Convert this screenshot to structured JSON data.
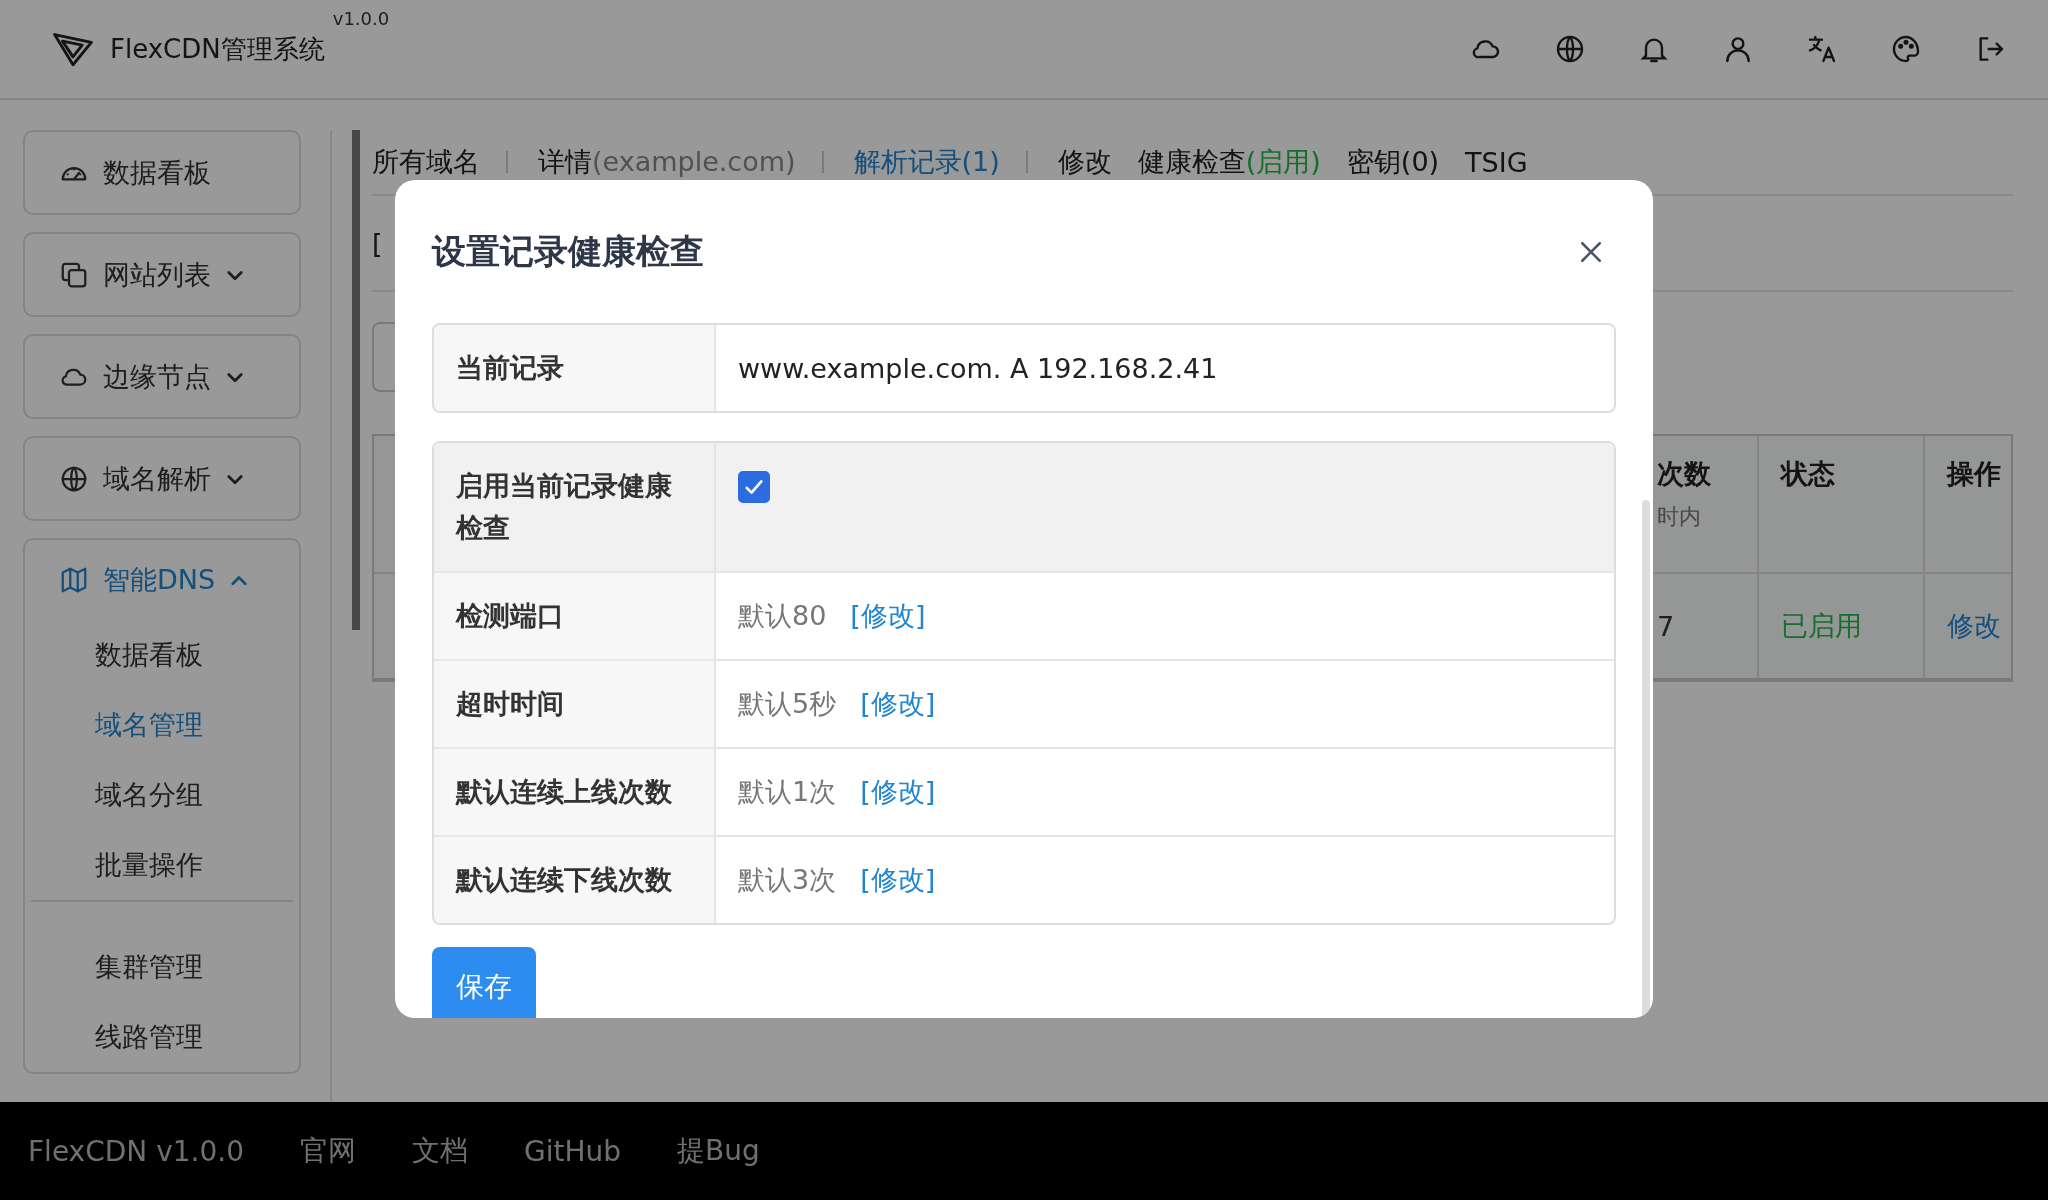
{
  "header": {
    "logo_text": "FlexCDN管理系统",
    "version": "v1.0.0"
  },
  "sidebar": {
    "items": [
      {
        "label": "数据看板",
        "kind": "link",
        "selected": false
      },
      {
        "label": "网站列表",
        "kind": "menu",
        "selected": false,
        "expanded": false
      },
      {
        "label": "边缘节点",
        "kind": "menu",
        "selected": false,
        "expanded": false
      },
      {
        "label": "域名解析",
        "kind": "menu",
        "selected": false,
        "expanded": false
      },
      {
        "label": "智能DNS",
        "kind": "menu",
        "selected": true,
        "expanded": true,
        "groups": [
          [
            {
              "label": "数据看板",
              "selected": false
            },
            {
              "label": "域名管理",
              "selected": true
            },
            {
              "label": "域名分组",
              "selected": false
            },
            {
              "label": "批量操作",
              "selected": false
            }
          ],
          [
            {
              "label": "集群管理",
              "selected": false
            },
            {
              "label": "线路管理",
              "selected": false
            }
          ]
        ]
      }
    ]
  },
  "tabs": [
    {
      "label": "所有域名",
      "selected": false
    },
    {
      "label": "详情",
      "note": "(example.com)",
      "kind": "muted",
      "selected": false
    },
    {
      "label": "解析记录(1)",
      "selected": true
    },
    {
      "label": "修改",
      "selected": false
    },
    {
      "label": "健康检查",
      "note": "(启用)",
      "kind": "success",
      "selected": false
    },
    {
      "label": "密钥(0)",
      "selected": false
    },
    {
      "label": "TSIG",
      "selected": false
    }
  ],
  "create_link": "[",
  "records_table": {
    "columns": [
      {
        "label": "次数",
        "sub": "时内"
      },
      {
        "label": "状态"
      },
      {
        "label": "操作"
      }
    ],
    "rows": [
      {
        "cells": [
          {
            "text": "7",
            "kind": "plain"
          },
          {
            "text": "已启用",
            "kind": "success"
          },
          {
            "text": "修改",
            "kind": "link"
          }
        ]
      }
    ]
  },
  "modal": {
    "title": "设置记录健康检查",
    "record": {
      "label": "当前记录",
      "value": "www.example.com. A 192.168.2.41"
    },
    "enable": {
      "label": "启用当前记录健康检查",
      "checked": true
    },
    "settings": [
      {
        "label": "检测端口",
        "value": "默认80",
        "action": "[修改]"
      },
      {
        "label": "超时时间",
        "value": "默认5秒",
        "action": "[修改]"
      },
      {
        "label": "默认连续上线次数",
        "value": "默认1次",
        "action": "[修改]"
      },
      {
        "label": "默认连续下线次数",
        "value": "默认3次",
        "action": "[修改]"
      }
    ],
    "save_button": "保存"
  },
  "footer": [
    "FlexCDN v1.0.0",
    "官网",
    "文档",
    "GitHub",
    "提Bug"
  ]
}
